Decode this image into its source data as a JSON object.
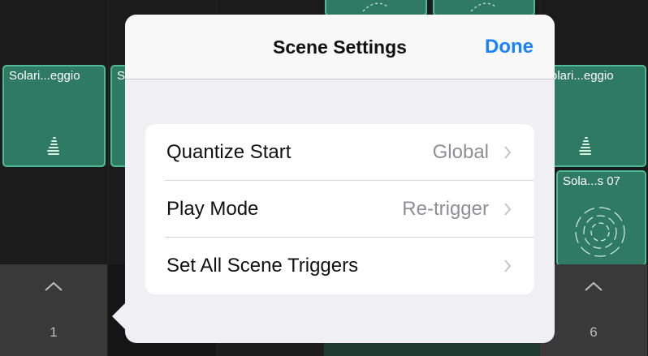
{
  "clip_cells": [
    {
      "label": "Solari...eggio"
    },
    {
      "label": "S"
    },
    {
      "label": "olari...eggio"
    },
    {
      "label": "Sola...s 07"
    }
  ],
  "scenes": [
    {
      "number": "1"
    },
    {
      "number": "6"
    }
  ],
  "popover": {
    "title": "Scene Settings",
    "done_label": "Done",
    "rows": [
      {
        "label": "Quantize Start",
        "value": "Global"
      },
      {
        "label": "Play Mode",
        "value": "Re-trigger"
      },
      {
        "label": "Set All Scene Triggers",
        "value": ""
      }
    ]
  },
  "colors": {
    "accent": "#1a82fb",
    "clip_fill": "#2f7a62",
    "clip_border": "#4fb894"
  }
}
